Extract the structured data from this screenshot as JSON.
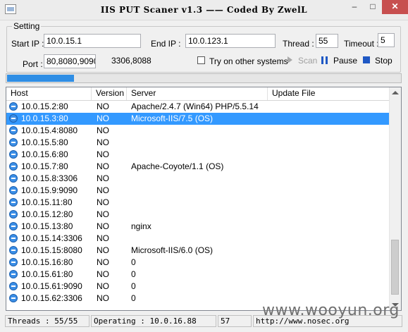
{
  "window": {
    "title": "IIS PUT Scaner v1.3 —— Coded By ZwelL",
    "minimize": "–",
    "maximize": "□",
    "close": "✕"
  },
  "setting": {
    "legend": "Setting",
    "start_ip_label": "Start IP :",
    "start_ip_value": "10.0.15.1",
    "end_ip_label": "End IP :",
    "end_ip_value": "10.0.123.1",
    "thread_label": "Thread :",
    "thread_value": "55",
    "timeout_label": "Timeout :",
    "timeout_value": "5",
    "port_label": "Port :",
    "port_value": "80,8080,9090",
    "port_extra_value": "3306,8088",
    "checkbox_label": "Try on other systems",
    "scan_label": "Scan",
    "pause_label": "Pause",
    "stop_label": "Stop"
  },
  "progress": {
    "value": 0.17
  },
  "list": {
    "columns": [
      "Host",
      "Version",
      "Server",
      "Update File"
    ],
    "rows": [
      {
        "host": "10.0.15.2:80",
        "ver": "NO",
        "srv": "Apache/2.4.7 (Win64) PHP/5.5.14",
        "upd": ""
      },
      {
        "host": "10.0.15.3:80",
        "ver": "NO",
        "srv": "Microsoft-IIS/7.5 (OS)",
        "upd": "",
        "selected": true
      },
      {
        "host": "10.0.15.4:8080",
        "ver": "NO",
        "srv": "",
        "upd": ""
      },
      {
        "host": "10.0.15.5:80",
        "ver": "NO",
        "srv": "",
        "upd": ""
      },
      {
        "host": "10.0.15.6:80",
        "ver": "NO",
        "srv": "",
        "upd": ""
      },
      {
        "host": "10.0.15.7:80",
        "ver": "NO",
        "srv": "Apache-Coyote/1.1 (OS)",
        "upd": ""
      },
      {
        "host": "10.0.15.8:3306",
        "ver": "NO",
        "srv": "",
        "upd": ""
      },
      {
        "host": "10.0.15.9:9090",
        "ver": "NO",
        "srv": "",
        "upd": ""
      },
      {
        "host": "10.0.15.11:80",
        "ver": "NO",
        "srv": "",
        "upd": ""
      },
      {
        "host": "10.0.15.12:80",
        "ver": "NO",
        "srv": "",
        "upd": ""
      },
      {
        "host": "10.0.15.13:80",
        "ver": "NO",
        "srv": "nginx",
        "upd": ""
      },
      {
        "host": "10.0.15.14:3306",
        "ver": "NO",
        "srv": "",
        "upd": ""
      },
      {
        "host": "10.0.15.15:8080",
        "ver": "NO",
        "srv": "Microsoft-IIS/6.0 (OS)",
        "upd": ""
      },
      {
        "host": "10.0.15.16:80",
        "ver": "NO",
        "srv": "0",
        "upd": ""
      },
      {
        "host": "10.0.15.61:80",
        "ver": "NO",
        "srv": "0",
        "upd": ""
      },
      {
        "host": "10.0.15.61:9090",
        "ver": "NO",
        "srv": "0",
        "upd": ""
      },
      {
        "host": "10.0.15.62:3306",
        "ver": "NO",
        "srv": "0",
        "upd": ""
      }
    ]
  },
  "status": {
    "threads": "Threads : 55/55",
    "operating": "Operating : 10.0.16.88",
    "count": "57",
    "url": "http://www.nosec.org"
  },
  "watermark": "www.wooyun.org"
}
